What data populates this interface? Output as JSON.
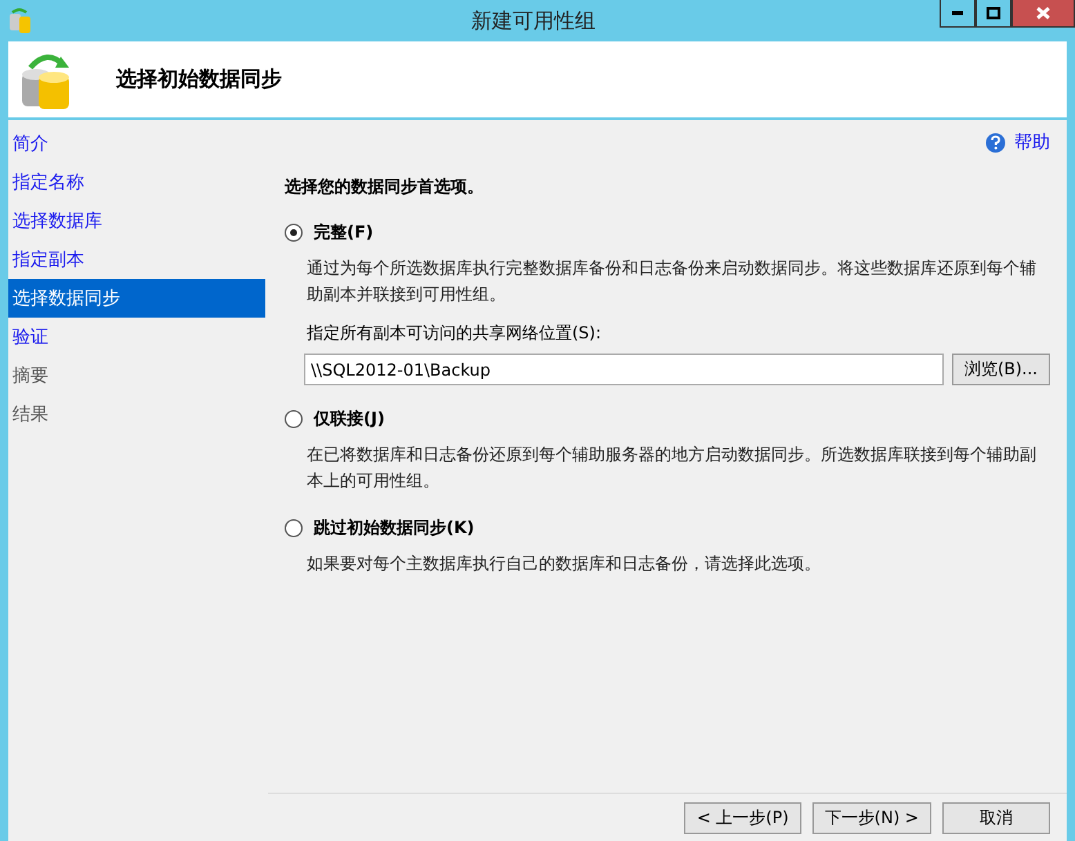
{
  "window": {
    "title": "新建可用性组"
  },
  "header": {
    "title": "选择初始数据同步"
  },
  "sidebar": {
    "items": [
      {
        "label": "简介",
        "selected": false,
        "disabled": false
      },
      {
        "label": "指定名称",
        "selected": false,
        "disabled": false
      },
      {
        "label": "选择数据库",
        "selected": false,
        "disabled": false
      },
      {
        "label": "指定副本",
        "selected": false,
        "disabled": false
      },
      {
        "label": "选择数据同步",
        "selected": true,
        "disabled": false
      },
      {
        "label": "验证",
        "selected": false,
        "disabled": false
      },
      {
        "label": "摘要",
        "selected": false,
        "disabled": true
      },
      {
        "label": "结果",
        "selected": false,
        "disabled": true
      }
    ]
  },
  "help": {
    "label": "帮助"
  },
  "prompt": "选择您的数据同步首选项。",
  "options": [
    {
      "label": "完整(F)",
      "selected": true,
      "description": "通过为每个所选数据库执行完整数据库备份和日志备份来启动数据同步。将这些数据库还原到每个辅助副本并联接到可用性组。",
      "share_label": "指定所有副本可访问的共享网络位置(S):",
      "share_value": "\\\\SQL2012-01\\Backup",
      "browse": "浏览(B)..."
    },
    {
      "label": "仅联接(J)",
      "selected": false,
      "description": "在已将数据库和日志备份还原到每个辅助服务器的地方启动数据同步。所选数据库联接到每个辅助副本上的可用性组。"
    },
    {
      "label": "跳过初始数据同步(K)",
      "selected": false,
      "description": "如果要对每个主数据库执行自己的数据库和日志备份，请选择此选项。"
    }
  ],
  "buttons": [
    {
      "label": "< 上一步(P)"
    },
    {
      "label": "下一步(N) >"
    },
    {
      "label": "取消"
    }
  ]
}
